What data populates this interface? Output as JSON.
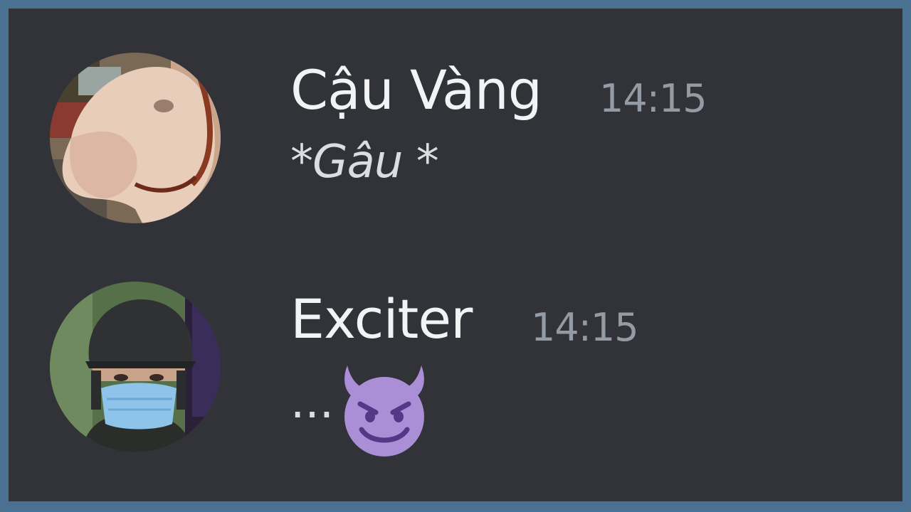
{
  "messages": [
    {
      "username": "Cậu Vàng",
      "timestamp": "14:15",
      "text": "*Gâu *",
      "avatar": "dog-avatar"
    },
    {
      "username": "Exciter",
      "timestamp": "14:15",
      "text": "...",
      "emoji": "smiling-imp-emoji",
      "avatar": "masked-soldier-avatar"
    }
  ],
  "colors": {
    "outer_border": "#4a7191",
    "background": "#313338",
    "username": "#f2f3f5",
    "timestamp": "#949ba4",
    "message_text": "#dbdee1",
    "emoji_purple": "#aa8ed6"
  }
}
